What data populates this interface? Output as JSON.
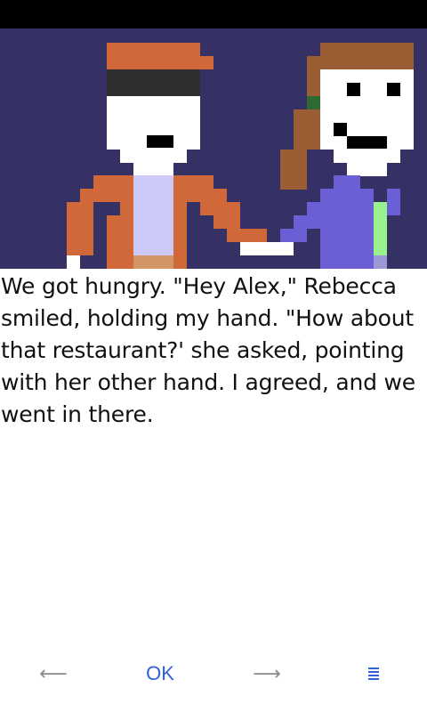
{
  "scene": {
    "background": "#353164",
    "characters": [
      "alex",
      "rebecca"
    ]
  },
  "story": {
    "text": "We got hungry. \"Hey Alex,\" Rebecca smiled, holding my hand. \"How about that restaurant?' she asked, pointing with her other hand. I agreed, and we went in there."
  },
  "app_bar": {
    "back_glyph": "⟵",
    "ok_label": "OK",
    "next_glyph": "⟶",
    "menu_icon": "menu-icon",
    "accent": "#2e63d8",
    "muted": "#8a8a8a"
  }
}
